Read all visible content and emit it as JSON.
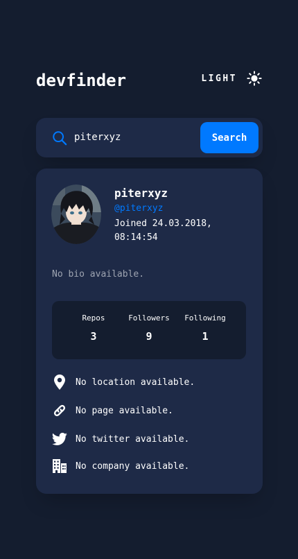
{
  "header": {
    "logo": "devfinder",
    "theme_label": "LIGHT",
    "theme_icon": "sun-icon"
  },
  "search": {
    "value": "piterxyz",
    "placeholder": "Search GitHub username…",
    "button_label": "Search",
    "icon": "search-icon"
  },
  "profile": {
    "name": "piterxyz",
    "login": "@piterxyz",
    "joined": "Joined 24.03.2018, 08:14:54",
    "bio": "No bio available.",
    "avatar": "avatar"
  },
  "stats": [
    {
      "label": "Repos",
      "value": "3"
    },
    {
      "label": "Followers",
      "value": "9"
    },
    {
      "label": "Following",
      "value": "1"
    }
  ],
  "links": [
    {
      "icon": "location-pin-icon",
      "text": "No location available."
    },
    {
      "icon": "link-icon",
      "text": "No page available."
    },
    {
      "icon": "twitter-icon",
      "text": "No twitter available."
    },
    {
      "icon": "building-icon",
      "text": "No company available."
    }
  ],
  "colors": {
    "background": "#141d2f",
    "card": "#1e2a47",
    "accent": "#0079ff",
    "text": "#ffffff"
  }
}
